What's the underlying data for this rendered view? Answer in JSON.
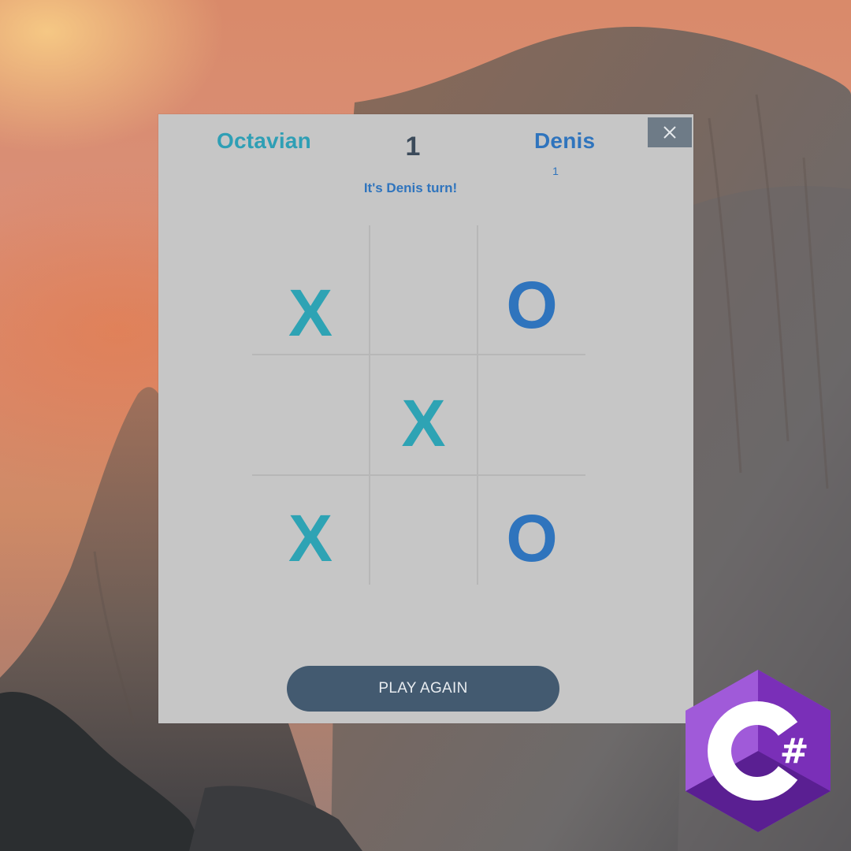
{
  "players": {
    "player1": {
      "name": "Octavian",
      "score": "1"
    },
    "player2": {
      "name": "Denis",
      "score": "1"
    }
  },
  "status": {
    "turn_text": "It's Denis turn!"
  },
  "board": {
    "cells": [
      "X",
      "",
      "O",
      "",
      "X",
      "",
      "X",
      "",
      "O"
    ]
  },
  "buttons": {
    "play_again": "PLAY AGAIN",
    "close_icon": "close-icon"
  },
  "logo": {
    "name": "csharp-logo",
    "text": "C#"
  },
  "colors": {
    "x_mark": "#2ea3b4",
    "o_mark": "#2f74bd",
    "window_bg": "#c6c6c6",
    "button_bg": "#435a70",
    "close_bg": "#6e7b87"
  }
}
